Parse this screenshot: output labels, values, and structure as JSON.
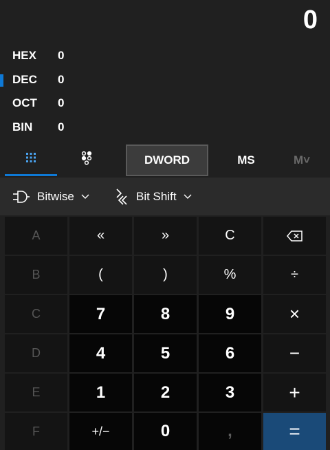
{
  "display": {
    "value": "0"
  },
  "radix": [
    {
      "label": "HEX",
      "value": "0",
      "active": false
    },
    {
      "label": "DEC",
      "value": "0",
      "active": true
    },
    {
      "label": "OCT",
      "value": "0",
      "active": false
    },
    {
      "label": "BIN",
      "value": "0",
      "active": false
    }
  ],
  "modebar": {
    "keypad_icon": "full-keypad-icon",
    "bitpad_icon": "bit-toggling-icon",
    "word_size": "DWORD",
    "memory_store": "MS",
    "memory_recall": "M˅"
  },
  "operators": {
    "bitwise": {
      "label": "Bitwise",
      "icon": "bitwise-gate-icon"
    },
    "bitshift": {
      "label": "Bit Shift",
      "icon": "bit-shift-icon"
    }
  },
  "keys": {
    "row1": [
      "A",
      "«",
      "»",
      "C",
      "backspace-icon"
    ],
    "row2": [
      "B",
      "(",
      ")",
      "%",
      "÷"
    ],
    "row3": [
      "C",
      "7",
      "8",
      "9",
      "×"
    ],
    "row4": [
      "D",
      "4",
      "5",
      "6",
      "−"
    ],
    "row5": [
      "E",
      "1",
      "2",
      "3",
      "+"
    ],
    "row6": [
      "F",
      "+/−",
      "0",
      ",",
      "="
    ]
  },
  "colors": {
    "accent": "#0e79d6",
    "equals_key": "#1a4a78",
    "background": "#202020",
    "number_key": "#060606",
    "operator_key": "#141414"
  }
}
